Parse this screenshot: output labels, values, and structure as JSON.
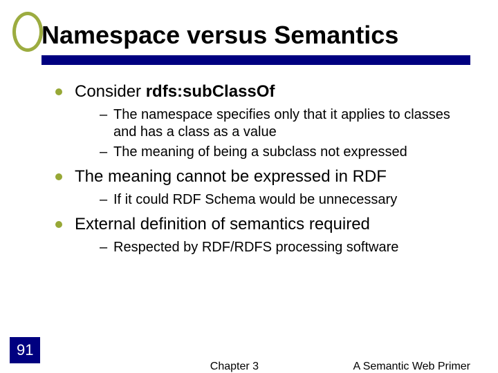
{
  "title": "Namespace versus Semantics",
  "bullets": [
    {
      "text_prefix": "Consider ",
      "text_bold": "rdfs:subClassOf",
      "text_suffix": "",
      "sub": [
        "The namespace specifies only that it applies to classes and has a class as a value",
        "The meaning of being a subclass not expressed"
      ]
    },
    {
      "text_prefix": "The meaning cannot be expressed in RDF",
      "text_bold": "",
      "text_suffix": "",
      "sub": [
        "If it could RDF Schema would be unnecessary"
      ]
    },
    {
      "text_prefix": " External definition of semantics required",
      "text_bold": "",
      "text_suffix": "",
      "sub": [
        "Respected by RDF/RDFS processing software"
      ]
    }
  ],
  "footer": {
    "page": "91",
    "center": "Chapter 3",
    "right": "A Semantic Web Primer"
  }
}
